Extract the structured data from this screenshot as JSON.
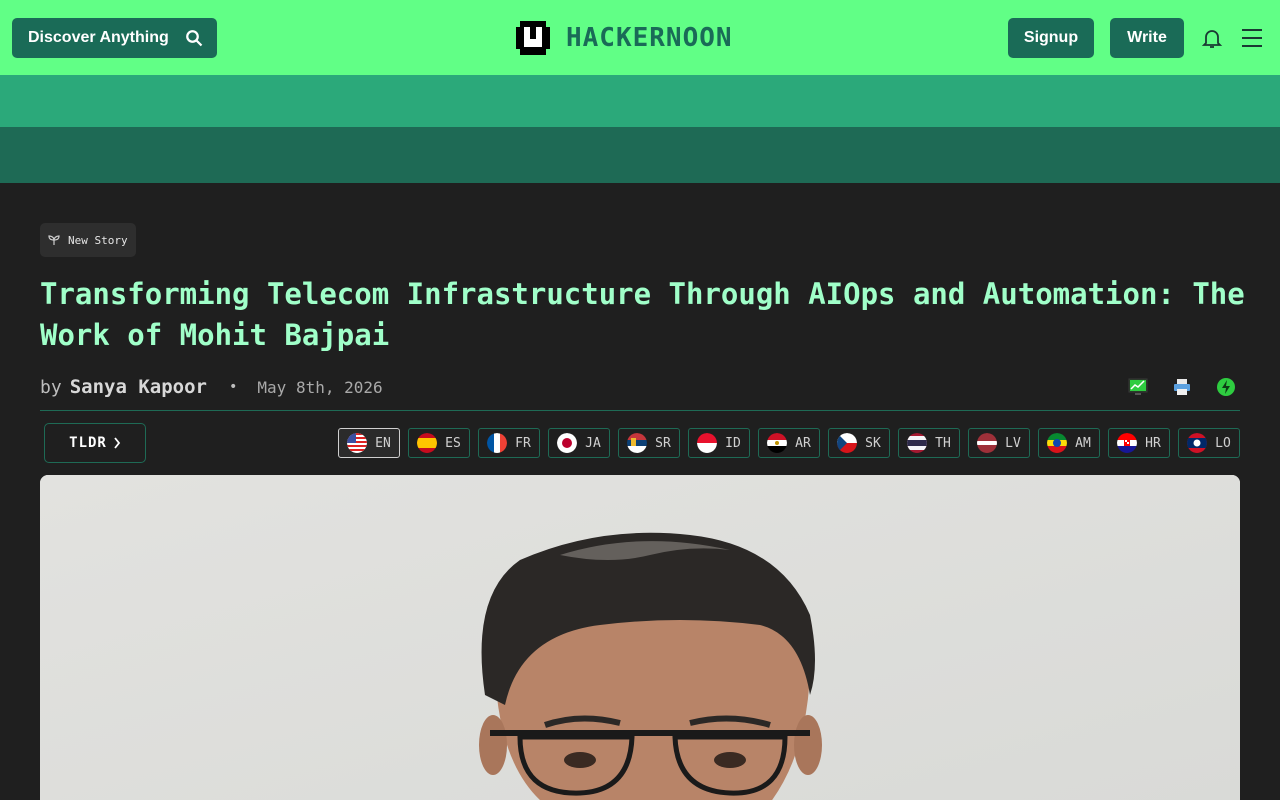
{
  "navbar": {
    "discover_label": "Discover Anything",
    "logo_text": "HACKERNOON",
    "signup_label": "Signup",
    "write_label": "Write"
  },
  "article": {
    "tag_label": "New Story",
    "title": "Transforming Telecom Infrastructure Through AIOps and Automation: The Work of Mohit Bajpai",
    "by_word": "by",
    "author": "Sanya Kapoor",
    "separator": "•",
    "date": "May 8th, 2026",
    "tldr_label": "TLDR",
    "languages": [
      {
        "code": "EN",
        "flag": "us-flag-icon"
      },
      {
        "code": "ES",
        "flag": "spain-flag-icon"
      },
      {
        "code": "FR",
        "flag": "france-flag-icon"
      },
      {
        "code": "JA",
        "flag": "japan-flag-icon"
      },
      {
        "code": "SR",
        "flag": "serbia-flag-icon"
      },
      {
        "code": "ID",
        "flag": "indonesia-flag-icon"
      },
      {
        "code": "AR",
        "flag": "egypt-flag-icon"
      },
      {
        "code": "SK",
        "flag": "czech-flag-icon"
      },
      {
        "code": "TH",
        "flag": "thailand-flag-icon"
      },
      {
        "code": "LV",
        "flag": "latvia-flag-icon"
      },
      {
        "code": "AM",
        "flag": "ethiopia-flag-icon"
      },
      {
        "code": "HR",
        "flag": "croatia-flag-icon"
      },
      {
        "code": "LO",
        "flag": "laos-flag-icon"
      }
    ],
    "active_language": "EN"
  },
  "colors": {
    "nav_green": "#61ff86",
    "button_green": "#1a6b57",
    "title_mint": "#a0ffc9",
    "page_bg": "#1f1f1f"
  }
}
